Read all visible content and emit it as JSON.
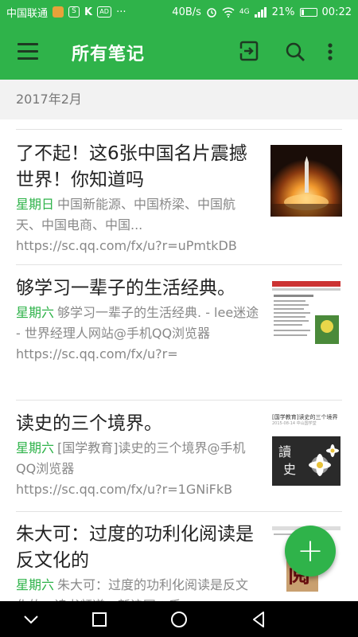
{
  "status_bar": {
    "carrier": "中国联通",
    "speed": "40B/s",
    "network": "4G",
    "battery": "21%",
    "battery_level": 0.21,
    "time": "00:22"
  },
  "app_bar": {
    "title": "所有笔记",
    "icons": [
      "menu-icon",
      "sync-icon",
      "search-icon",
      "more-icon"
    ]
  },
  "list": {
    "section_header": "2017年2月",
    "notes": [
      {
        "title": "了不起！这6张中国名片震撼世界！你知道吗",
        "day": "星期日",
        "snippet": "中国新能源、中国桥梁、中国航天、中国电商、中国...",
        "url": "https://sc.qq.com/fx/u?r=uPmtkDB"
      },
      {
        "title": "够学习一辈子的生活经典。",
        "day": "星期六",
        "snippet": "够学习一辈子的生活经典. - lee迷途 - 世界经理人网站@手机QQ浏览器 https://sc.qq.com/fx/u?r=",
        "url": ""
      },
      {
        "title": "读史的三个境界。",
        "day": "星期六",
        "snippet": "[国学教育]读史的三个境界@手机QQ浏览器",
        "url": "https://sc.qq.com/fx/u?r=1GNiFkB",
        "thumb_title": "[国学教育]读史的三个境界",
        "thumb_meta": "2015-08-14  中山国学堂",
        "thumb_calligraphy": [
          "讀",
          "史"
        ]
      },
      {
        "title": "朱大可：过度的功利化阅读是反文化的",
        "day": "星期六",
        "snippet": "朱大可：过度的功利化阅读是反文化的 - 读书频道 - 新浪网@手",
        "url": "",
        "thumb_glyph": "阅"
      }
    ]
  },
  "fab": {
    "label": "+"
  },
  "colors": {
    "accent": "#2fb34a",
    "title_text": "#222222",
    "snippet_text": "#888888"
  }
}
